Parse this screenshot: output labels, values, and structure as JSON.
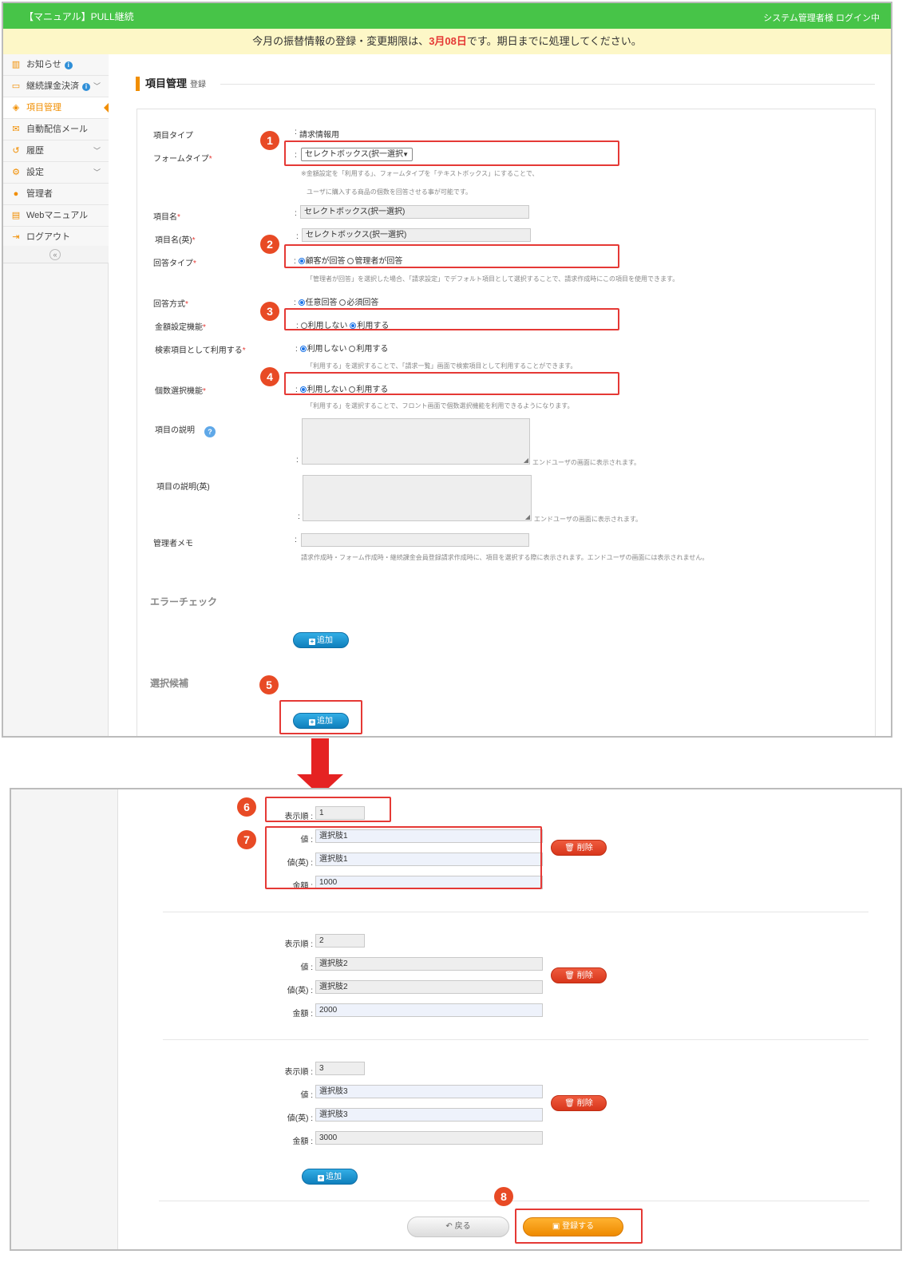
{
  "header": {
    "app_title": "【マニュアル】PULL継続",
    "login_status": "システム管理者様 ログイン中"
  },
  "notice": {
    "prefix": "今月の振替情報の登録・変更期限は、",
    "deadline": "3月08日",
    "suffix": "です。期日までに処理してください。"
  },
  "sidebar": {
    "items": [
      {
        "label": "お知らせ",
        "icon": "chart-icon",
        "info": true
      },
      {
        "label": "継続課金決済",
        "icon": "card-icon",
        "info": true,
        "chevron": true
      },
      {
        "label": "項目管理",
        "icon": "cubes-icon",
        "active": true
      },
      {
        "label": "自動配信メール",
        "icon": "mail-icon"
      },
      {
        "label": "履歴",
        "icon": "history-icon",
        "chevron": true
      },
      {
        "label": "設定",
        "icon": "gears-icon",
        "chevron": true
      },
      {
        "label": "管理者",
        "icon": "user-icon"
      },
      {
        "label": "Webマニュアル",
        "icon": "book-icon"
      },
      {
        "label": "ログアウト",
        "icon": "logout-icon"
      }
    ],
    "collapse_glyph": "«"
  },
  "page": {
    "title": "項目管理",
    "subtitle": "登録"
  },
  "form": {
    "item_type": {
      "label": "項目タイプ",
      "value": "請求情報用"
    },
    "form_type": {
      "label": "フォームタイプ",
      "required": "*",
      "value": "セレクトボックス(択一選択",
      "hint1": "※金額設定を「利用する」、フォームタイプを「テキストボックス」にすることで、",
      "hint2": "ユーザに購入する商品の個数を回答させる事が可能です。"
    },
    "item_name": {
      "label": "項目名",
      "required": "*",
      "value": "セレクトボックス(択一選択)"
    },
    "item_name_en": {
      "label": "項目名(英)",
      "required": "*",
      "value": "セレクトボックス(択一選択)"
    },
    "answer_type": {
      "label": "回答タイプ",
      "required": "*",
      "options": [
        {
          "label": "顧客が回答",
          "checked": true
        },
        {
          "label": "管理者が回答",
          "checked": false
        }
      ],
      "hint": "「管理者が回答」を選択した場合、「請求設定」でデフォルト項目として選択することで、請求作成時にこの項目を使用できます。"
    },
    "answer_method": {
      "label": "回答方式",
      "required": "*",
      "options": [
        {
          "label": "任意回答",
          "checked": true
        },
        {
          "label": "必須回答",
          "checked": false
        }
      ]
    },
    "amount_setting": {
      "label": "金額設定機能",
      "required": "*",
      "options": [
        {
          "label": "利用しない",
          "checked": false
        },
        {
          "label": "利用する",
          "checked": true
        }
      ]
    },
    "search_item": {
      "label": "検索項目として利用する",
      "required": "*",
      "options": [
        {
          "label": "利用しない",
          "checked": true
        },
        {
          "label": "利用する",
          "checked": false
        }
      ],
      "hint": "「利用する」を選択することで、「請求一覧」画面で検索項目として利用することができます。"
    },
    "qty_select": {
      "label": "個数選択機能",
      "required": "*",
      "options": [
        {
          "label": "利用しない",
          "checked": true
        },
        {
          "label": "利用する",
          "checked": false
        }
      ],
      "hint": "「利用する」を選択することで、フロント画面で個数選択機能を利用できるようになります。"
    },
    "description": {
      "label": "項目の説明",
      "help": "?",
      "hint": "エンドユーザの画面に表示されます。"
    },
    "description_en": {
      "label": "項目の説明(英)",
      "hint": "エンドユーザの画面に表示されます。"
    },
    "admin_memo": {
      "label": "管理者メモ",
      "hint": "請求作成時・フォーム作成時・継続課金会員登録請求作成時に、項目を選択する際に表示されます。エンドユーザの画面には表示されません。"
    },
    "colon": ":"
  },
  "error_check": {
    "title": "エラーチェック",
    "add_label": "追加"
  },
  "choices": {
    "title": "選択候補",
    "add_label": "追加"
  },
  "choice_rows": {
    "order_label": "表示順",
    "value_label": "値",
    "value_en_label": "値(英)",
    "amount_label": "金額",
    "delete_label": "削除",
    "rows": [
      {
        "order": "1",
        "value": "選択肢1",
        "value_en": "選択肢1",
        "amount": "1000"
      },
      {
        "order": "2",
        "value": "選択肢2",
        "value_en": "選択肢2",
        "amount": "2000"
      },
      {
        "order": "3",
        "value": "選択肢3",
        "value_en": "選択肢3",
        "amount": "3000"
      }
    ],
    "add_label": "追加"
  },
  "footer": {
    "back_label": "戻る",
    "save_label": "登録する"
  },
  "markers": [
    "1",
    "2",
    "3",
    "4",
    "5",
    "6",
    "7",
    "8"
  ],
  "colors": {
    "brand_green": "#47c448",
    "accent_orange": "#f18e00",
    "highlight_red": "#e53935",
    "button_blue": "#1a8bc7"
  }
}
